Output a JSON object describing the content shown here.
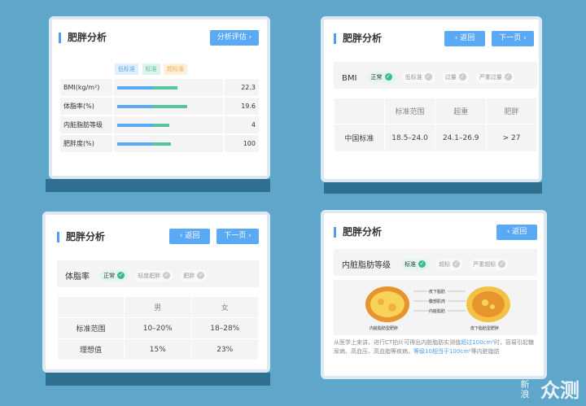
{
  "panel1": {
    "title": "肥胖分析",
    "button": "分析评估",
    "headers": [
      "低标准",
      "标准",
      "超标准"
    ],
    "rows": [
      {
        "label": "BMI(kg/m²)",
        "value": "22.3",
        "level": 0.62
      },
      {
        "label": "体脂率(%)",
        "value": "19.6",
        "level": 0.72
      },
      {
        "label": "内脏脂肪等级",
        "value": "4",
        "level": 0.5
      },
      {
        "label": "肥胖度(%)",
        "value": "100",
        "level": 0.55
      }
    ]
  },
  "panel2": {
    "title": "肥胖分析",
    "back": "返回",
    "next": "下一页",
    "metric": "BMI",
    "tags": [
      "正常",
      "低标准",
      "过量",
      "严重过量"
    ],
    "table": {
      "headers": [
        "",
        "标准范围",
        "超重",
        "肥胖"
      ],
      "row": [
        "中国标准",
        "18.5–24.0",
        "24.1–26.9",
        "> 27"
      ]
    }
  },
  "panel3": {
    "title": "肥胖分析",
    "back": "返回",
    "next": "下一页",
    "metric": "体脂率",
    "tags": [
      "正常",
      "轻度肥胖",
      "肥胖"
    ],
    "table": {
      "headers": [
        "",
        "男",
        "女"
      ],
      "rows": [
        [
          "标准范围",
          "10–20%",
          "18–28%"
        ],
        [
          "理想值",
          "15%",
          "23%"
        ]
      ]
    }
  },
  "panel4": {
    "title": "肥胖分析",
    "back": "返回",
    "metric": "内脏脂肪等级",
    "tags": [
      "标准",
      "超标",
      "严重超标"
    ],
    "labels": [
      "皮下脂肪",
      "腹部肌肉",
      "内脏脂肪"
    ],
    "caption_left": "内脏脂肪型肥胖",
    "caption_right": "皮下脂肪型肥胖",
    "text1": "从医学上来讲，进行CT拍片可得出内脏脂肪实测值",
    "hl1": "超过100cm²",
    "text2": "时，容易引起糖尿病、高血压、高血脂等疾病，",
    "hl2": "等级10相当于100cm²",
    "text3": "等内脏脂肪"
  },
  "watermark": {
    "big": "众测",
    "small": "新浪"
  }
}
